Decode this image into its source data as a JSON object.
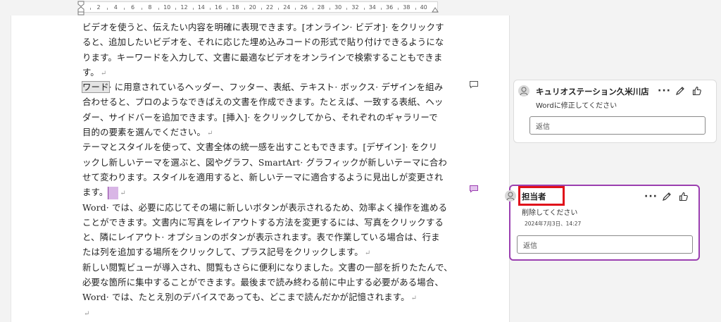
{
  "ruler": {
    "numbers": [
      "2",
      "4",
      "6",
      "8",
      "10",
      "12",
      "14",
      "16",
      "18",
      "20",
      "22",
      "24",
      "26",
      "28",
      "30",
      "32",
      "34",
      "36",
      "38",
      "40"
    ]
  },
  "document": {
    "lines": [
      "ビデオを使うと、伝えたい内容を明確に表現できます。[オンライン· ビデオ]· をクリックす",
      "ると、追加したいビデオを、それに応じた埋め込みコードの形式で貼り付けできるようにな",
      "ります。キーワードを入力して、文書に最適なビデオをオンラインで検索することもできま",
      "す。",
      "· に用意されているヘッダー、フッター、表紙、テキスト· ボックス· デザインを組み",
      "合わせると、プロのようなできばえの文書を作成できます。たとえば、一致する表紙、ヘッ",
      "ダー、サイドバーを追加できます。[挿入]· をクリックしてから、それぞれのギャラリーで",
      "目的の要素を選んでください。",
      "テーマとスタイルを使って、文書全体の統一感を出すこともできます。[デザイン]· をクリ",
      "ックし新しいテーマを選ぶと、図やグラフ、SmartArt· グラフィックが新しいテーマに合わ",
      "せて変わります。スタイルを適用すると、新しいテーマに適合するように見出しが変更され",
      "ます。",
      "Word· では、必要に応じてその場に新しいボタンが表示されるため、効率よく操作を進める",
      "ことができます。文書内に写真をレイアウトする方法を変更するには、写真をクリックする",
      "と、隣にレイアウト· オプションのボタンが表示されます。表で作業している場合は、行ま",
      "たは列を追加する場所をクリックして、プラス記号をクリックします。",
      "新しい閲覧ビューが導入され、閲覧もさらに便利になりました。文書の一部を折りたたんで、",
      "必要な箇所に集中することができます。最後まで読み終わる前に中止する必要がある場合、",
      "Word· では、たとえ別のデバイスであっても、どこまで読んだかが記憶されます。"
    ],
    "highlighted_word": "ワード",
    "para_mark": "↵"
  },
  "comments": [
    {
      "author": "キュリオステーション久米川店",
      "text": "Wordに修正してください",
      "reply_placeholder": "返信"
    },
    {
      "author": "担当者",
      "text": "削除してください",
      "date": "2024年7月3日、14:27",
      "reply_placeholder": "返信"
    }
  ],
  "icons": {
    "more": "more-options-icon",
    "edit": "pencil-icon",
    "like": "thumbs-up-icon",
    "comment_marker": "comment-marker-icon",
    "avatar": "user-avatar-icon"
  },
  "colors": {
    "active_border": "#9b3fb0",
    "annotation_red": "#e0101a",
    "comment_marker_active": "#c27fd6"
  }
}
